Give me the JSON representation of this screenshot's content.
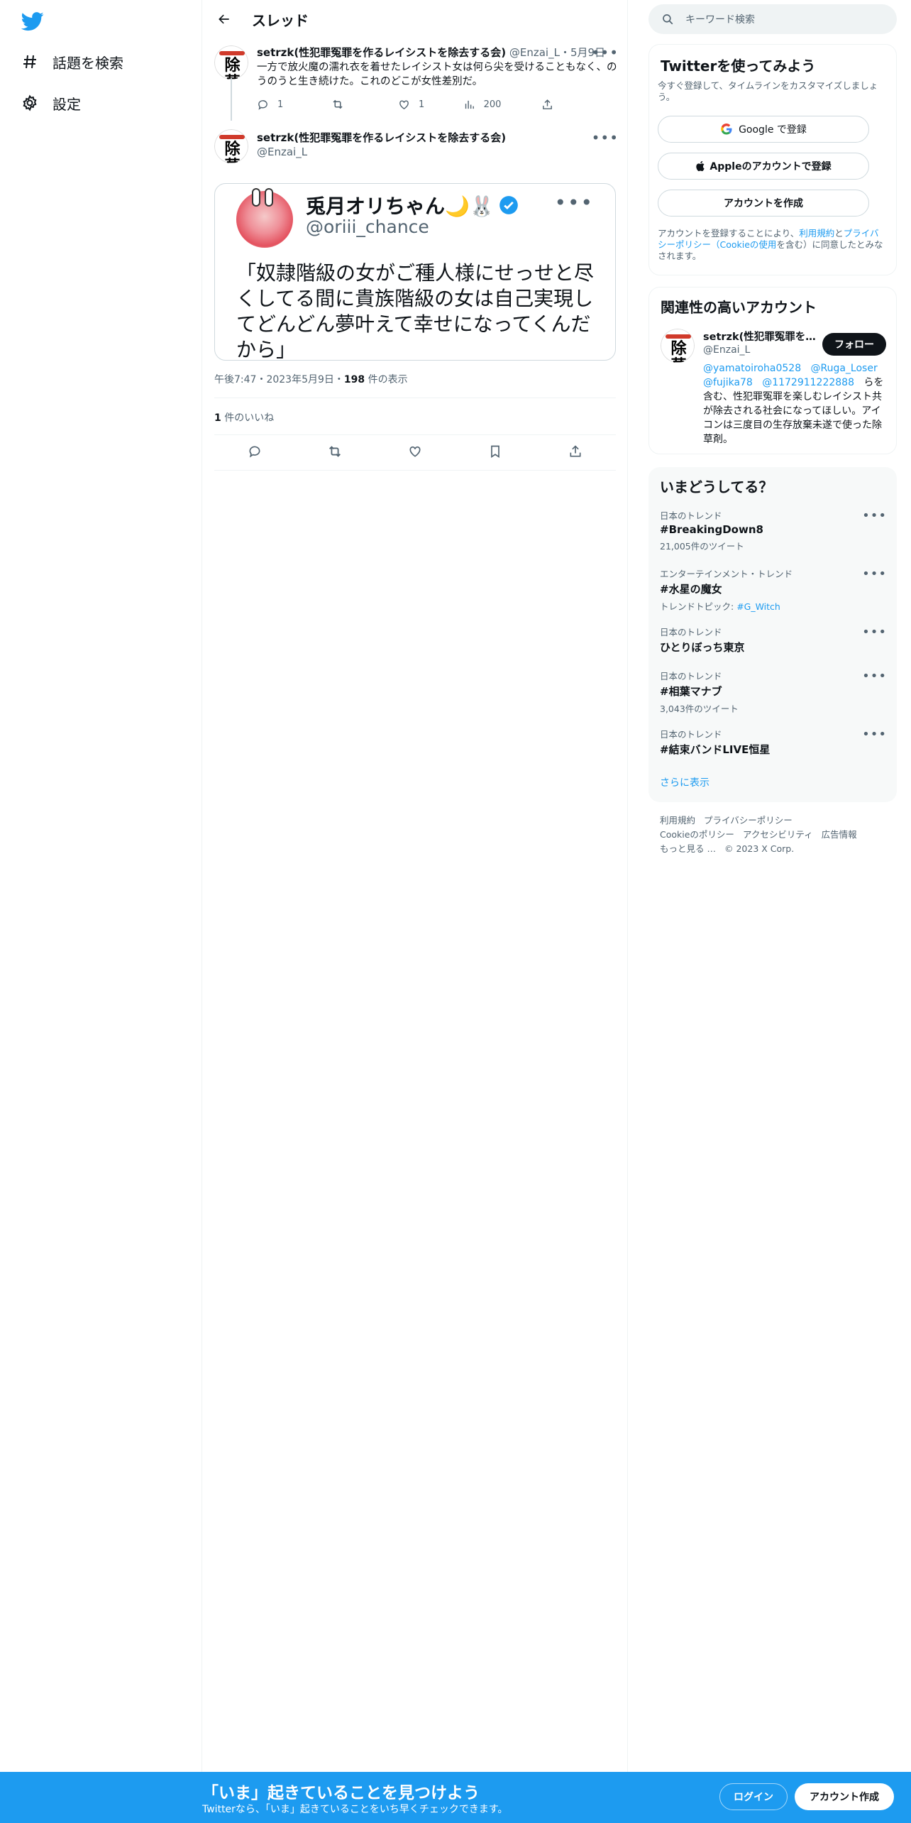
{
  "nav": {
    "logo_icon": "twitter-bird-icon",
    "items": [
      {
        "label": "話題を検索",
        "icon": "hashtag-icon"
      },
      {
        "label": "設定",
        "icon": "gear-icon"
      }
    ]
  },
  "main": {
    "header_title": "スレッド",
    "tweet1": {
      "name": "setrzk(性犯罪冤罪を作るレイシストを除去する会)",
      "handle": "@Enzai_L",
      "sep": "・",
      "date": "5月9日",
      "text": "一方で放火魔の濡れ衣を着せたレイシスト女は何ら尖を受けることもなく、のうのうと生き続けた。これのどこが女性差別だ。",
      "replies": "1",
      "retweets": "",
      "likes": "1",
      "views": "200"
    },
    "tweet2": {
      "name": "setrzk(性犯罪冤罪を作るレイシストを除去する会)",
      "handle": "@Enzai_L",
      "image": {
        "name": "兎月オリちゃん🌙🐰",
        "handle": "@oriii_chance",
        "text": "「奴隷階級の女がご種人様にせっせと尽くしてる間に貴族階級の女は自己実現してどんどん夢叶えて幸せになってくんだから」"
      },
      "time": "午後7:47",
      "date": "2023年5月9日",
      "views_count": "198",
      "views_label": "件の表示",
      "likes_count": "1",
      "likes_label": "件のいいね"
    }
  },
  "sidebar": {
    "search_placeholder": "キーワード検索",
    "signup": {
      "title": "Twitterを使ってみよう",
      "subtitle": "今すぐ登録して、タイムラインをカスタマイズしましょう。",
      "google_label": "Google で登録",
      "apple_label": "Appleのアカウントで登録",
      "create_label": "アカウントを作成",
      "terms_prefix": "アカウントを登録することにより、",
      "terms_link1": "利用規約",
      "terms_and": "と",
      "terms_link2": "プライバシーポリシー（Cookieの使用",
      "terms_suffix": "を含む）に同意したとみなされます。"
    },
    "related": {
      "title": "関連性の高いアカウント",
      "name": "setrzk(性犯罪冤罪を…",
      "handle": "@Enzai_L",
      "follow_label": "フォロー",
      "bio_links": [
        "@yamatoiroha0528",
        "@Ruga_Loser",
        "@fujika78",
        "@1172911222888"
      ],
      "bio_text": "らを含む、性犯罪冤罪を楽しむレイシスト共が除去される社会になってほしい。アイコンは三度目の生存放棄未遂で使った除草剤。"
    },
    "trends": {
      "title": "いまどうしてる？",
      "items": [
        {
          "category": "日本のトレンド",
          "name": "#BreakingDown8",
          "sub": "21,005件のツイート",
          "sub_link": ""
        },
        {
          "category": "エンターテインメント・トレンド",
          "name": "#水星の魔女",
          "sub": "トレンドトピック: ",
          "sub_link": "#G_Witch"
        },
        {
          "category": "日本のトレンド",
          "name": "ひとりぼっち東京",
          "sub": "",
          "sub_link": ""
        },
        {
          "category": "日本のトレンド",
          "name": "#相葉マナブ",
          "sub": "3,043件のツイート",
          "sub_link": ""
        },
        {
          "category": "日本のトレンド",
          "name": "#結束バンドLIVE恒星",
          "sub": "",
          "sub_link": ""
        }
      ],
      "show_more": "さらに表示"
    },
    "footer": {
      "row1": [
        "利用規約",
        "プライバシーポリシー"
      ],
      "row2": [
        "Cookieのポリシー",
        "アクセシビリティ",
        "広告情報"
      ],
      "row3": [
        "もっと見る …",
        "© 2023 X Corp."
      ]
    }
  },
  "bottom_bar": {
    "title": "「いま」起きていることを見つけよう",
    "subtitle": "Twitterなら、「いま」起きていることをいち早くチェックできます。",
    "login_label": "ログイン",
    "signup_label": "アカウント作成"
  },
  "colors": {
    "brand_blue": "#1d9bf0",
    "text": "#0f1419",
    "muted": "#536471"
  }
}
